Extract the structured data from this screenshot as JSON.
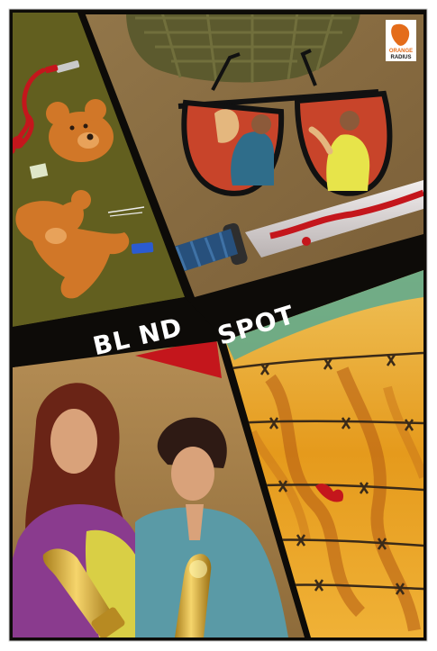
{
  "poster": {
    "title_left": "BL ND",
    "title_right": "SPOT",
    "logo": {
      "top_text": "ORANGE",
      "bottom_text": "RADIUS"
    },
    "colors": {
      "background_white": "#ffffff",
      "divider_black": "#0d0b08",
      "panel_top_left": "#5d5a1c",
      "panel_top_right": "#8c6e43",
      "panel_bottom_left": "#a9824e",
      "panel_bottom_right": "#e8a322",
      "red_accent": "#c4161c",
      "glasses_lens": "#c8442a",
      "knife_handle": "#27507c",
      "teddy_orange": "#d17728",
      "bullet_gold": "#e0b13a"
    },
    "icons": [
      "teddy-bear-icon",
      "sunglasses-icon",
      "knife-icon",
      "barbed-wire-icon",
      "bullet-icon",
      "army-helmet-icon",
      "lipstick-icon",
      "blood-splatter-icon"
    ]
  }
}
